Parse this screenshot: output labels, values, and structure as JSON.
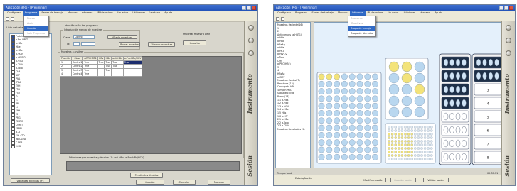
{
  "colors": {
    "titlebar": "#2253b8",
    "selection": "#316ac5",
    "plate_well": "#b9d7ef",
    "plate_well_yellow": "#f3e37a",
    "rack_dark": "#1e3048"
  },
  "left_window": {
    "title": "Aplicación iPRo - [Preliminar]",
    "menu": [
      "Configurar",
      "Programa",
      "Series de trabajo",
      "Mostrar",
      "Informes",
      "IB Historicos",
      "Usuarios",
      "Utilidades",
      "Ventana",
      "Ayuda"
    ],
    "active_menu_index": 1,
    "dropdown": [
      {
        "label": "Nuevo",
        "state": "disabled"
      },
      {
        "label": "Abrir",
        "state": "disabled"
      },
      {
        "label": "Guardar",
        "state": "highlight"
      },
      {
        "label": "Salir Programa",
        "state": "disabled"
      }
    ],
    "tree_header": "Lista de trabajo",
    "tree_items": [
      "Proteínas",
      "a-Pro-HBT1",
      "a-HBc",
      "HBe",
      "a-HBe",
      "a-HCV",
      "a-HIV1/2",
      "a-HTLV",
      "a-CMV",
      "a-Toxo",
      "CEA",
      "AFP",
      "PSA",
      "fPSA",
      "TSH",
      "FT4",
      "FT3",
      "T4",
      "T3",
      "PRL",
      "LH",
      "FSH",
      "E2",
      "PRG",
      "TESTO",
      "CORTI",
      "FERRI",
      "B12",
      "FOLATO",
      "INSULINA",
      "C-PEP",
      "HCG"
    ],
    "checked_items": [
      0,
      1,
      2,
      3,
      4,
      5,
      6
    ],
    "form": {
      "group_title": "Identificación del programa",
      "group2_title": "Introducción manual de muestras",
      "class_label": "Clase:",
      "class_value": "Control",
      "id_label": "Id:",
      "id_value": "",
      "add_button": "Añadir muestras",
      "delete_button": "Borrar muestra",
      "remove_all_button": "Eliminar muestras",
      "import_label": "Importar muestra LIMS",
      "import_button": "Importar",
      "samples_group": "Muestras a analizar",
      "table_headers": [
        "Posición",
        "Clase",
        "ANTI-HBT1",
        "HBs",
        "HBc",
        "anti-HBs",
        "a-Pro-HBc/HCV"
      ],
      "table_rows": [
        [
          "1",
          "Control1",
          "True",
          "True",
          "True",
          "True",
          "True"
        ],
        [
          "2",
          "Control2",
          "True",
          "",
          "True",
          "True",
          ""
        ],
        [
          "3",
          "Control3",
          "True",
          "",
          "True",
          "",
          ""
        ],
        [
          "4",
          "Control4",
          "True",
          "",
          "",
          "",
          ""
        ]
      ],
      "selected_cell": [
        0,
        6
      ],
      "dilutions_label": "Diluciones por muestra y técnica (1: anti-HBs, a-Pro-HBc/HCV)",
      "dilutions_button": "Pendientes diluídas",
      "select_all_button": "Visualizar técnicas (+)",
      "save_button": "Guardar",
      "cancel_button": "Cancelar",
      "process_button": "Procesar"
    },
    "side_text": "Instrumento",
    "side_text2": "Sesión"
  },
  "right_window": {
    "title": "Aplicación iPRo - [Preliminar]",
    "menu": [
      "Configurar",
      "Programa",
      "Series de trabajo",
      "Mostrar",
      "Informes",
      "IB Historicos",
      "Usuarios",
      "Utilidades",
      "Ventana",
      "Ayuda"
    ],
    "active_menu_index": 4,
    "dropdown": [
      {
        "label": "Muestras",
        "state": "disabled"
      },
      {
        "label": "Reactivos",
        "state": "disabled"
      },
      {
        "label": "Mapa de trabajo",
        "state": "highlight"
      },
      {
        "label": "Mapa de fórmulas",
        "state": "normal"
      }
    ],
    "tree_items": [
      "Muestras Paciente(16)",
      "1",
      "2",
      "Anticuerpos (a-HBT1)",
      "a-HBs",
      "a-HBc",
      "HBeAg",
      "a-HBe",
      "a-HCV",
      "a-HIV1/2",
      "a-Toxo",
      "CMV",
      "a-PRO(HBc)",
      "3",
      "4",
      "HBsAg",
      "a-CMV",
      "Muestras Control(7)",
      "Reactivos (13)",
      "Conjugado HBs",
      "Tampón PBS",
      "Substrato TMB",
      "Pozos (13)",
      "1.1 a-HBs",
      "1.2 a-HBc",
      "1.3 a-HCV",
      "1.4 a-HBe",
      "1.5 HBs",
      "1.6 a-HIV",
      "2.1 a-HBs",
      "2.2 a-Toxo",
      "2.3 a-CMV",
      "Muestras Resultados (9)"
    ],
    "status_left": "Tiempo total",
    "status_right": "02:37:11",
    "bottom_label": "Estado/Acción",
    "bottom_buttons": [
      "Modificar sesión",
      "Guardar sesión",
      "Validar sesión"
    ],
    "rack_labels": [
      "1",
      "2",
      "3",
      "4",
      "5",
      "6",
      "7",
      "8"
    ],
    "side_text": "Instrumento",
    "side_text2": "Sesión"
  }
}
